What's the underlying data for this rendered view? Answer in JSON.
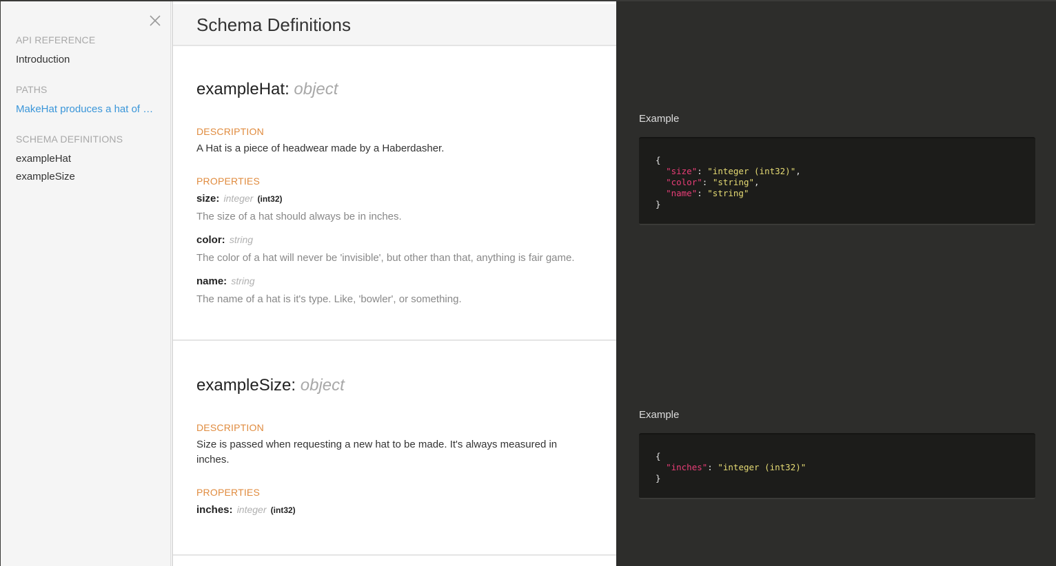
{
  "sidebar": {
    "sections": [
      {
        "label": "API REFERENCE",
        "items": [
          {
            "label": "Introduction",
            "active": false
          }
        ]
      },
      {
        "label": "PATHS",
        "items": [
          {
            "label": "MakeHat produces a hat of …",
            "active": true
          }
        ]
      },
      {
        "label": "SCHEMA DEFINITIONS",
        "items": [
          {
            "label": "exampleHat",
            "active": false
          },
          {
            "label": "exampleSize",
            "active": false
          }
        ]
      }
    ]
  },
  "header": {
    "title": "Schema Definitions"
  },
  "definitions": [
    {
      "name": "exampleHat:",
      "type": "object",
      "description_label": "DESCRIPTION",
      "description": "A Hat is a piece of headwear made by a Haberdasher.",
      "properties_label": "PROPERTIES",
      "properties": [
        {
          "name": "size:",
          "type": "integer",
          "format": "(int32)",
          "description": "The size of a hat should always be in inches."
        },
        {
          "name": "color:",
          "type": "string",
          "format": "",
          "description": "The color of a hat will never be 'invisible', but other than that, anything is fair game."
        },
        {
          "name": "name:",
          "type": "string",
          "format": "",
          "description": "The name of a hat is it's type. Like, 'bowler', or something."
        }
      ],
      "example_label": "Example",
      "example": {
        "open": "{",
        "close": "}",
        "lines": [
          {
            "key": "\"size\"",
            "value": "\"integer (int32)\"",
            "comma": ","
          },
          {
            "key": "\"color\"",
            "value": "\"string\"",
            "comma": ","
          },
          {
            "key": "\"name\"",
            "value": "\"string\"",
            "comma": ""
          }
        ]
      }
    },
    {
      "name": "exampleSize:",
      "type": "object",
      "description_label": "DESCRIPTION",
      "description": "Size is passed when requesting a new hat to be made. It's always measured in inches.",
      "properties_label": "PROPERTIES",
      "properties": [
        {
          "name": "inches:",
          "type": "integer",
          "format": "(int32)",
          "description": ""
        }
      ],
      "example_label": "Example",
      "example": {
        "open": "{",
        "close": "}",
        "lines": [
          {
            "key": "\"inches\"",
            "value": "\"integer (int32)\"",
            "comma": ""
          }
        ]
      }
    }
  ],
  "colors": {
    "accent_link": "#3a96d9",
    "section_label_orange": "#e08b3e",
    "code_key": "#ea3e78",
    "code_value": "#e6db74",
    "dark_panel": "#2d2d2b"
  },
  "icons": {
    "close": "close-icon"
  }
}
